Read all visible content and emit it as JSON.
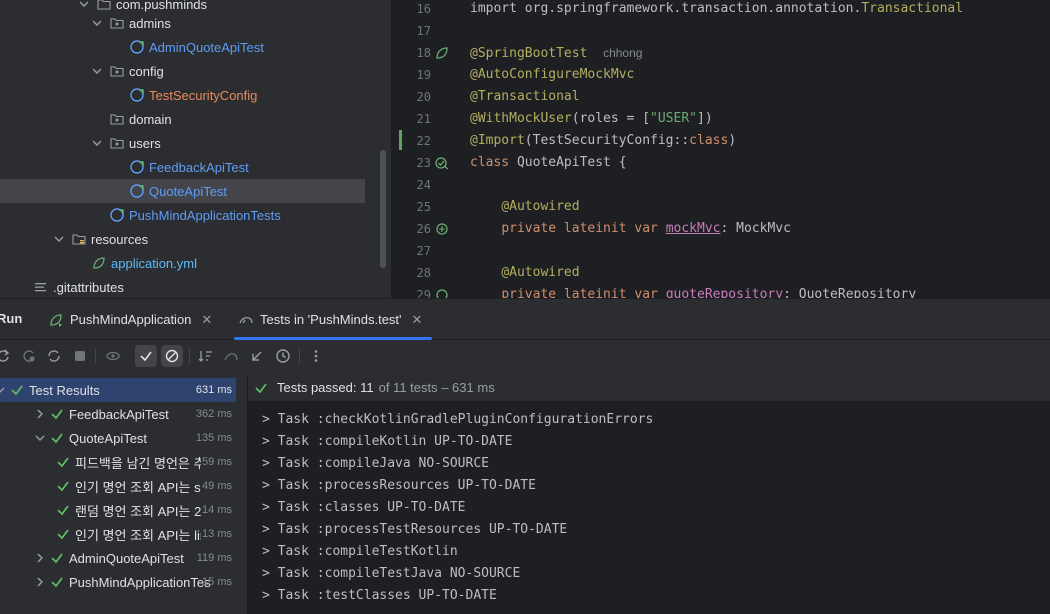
{
  "project_tree": {
    "items": [
      {
        "label": "com.pushminds",
        "kind": "package"
      },
      {
        "label": "admins",
        "kind": "package"
      },
      {
        "label": "AdminQuoteApiTest",
        "kind": "kotlin-test"
      },
      {
        "label": "config",
        "kind": "package"
      },
      {
        "label": "TestSecurityConfig",
        "kind": "kotlin-config"
      },
      {
        "label": "domain",
        "kind": "package"
      },
      {
        "label": "users",
        "kind": "package"
      },
      {
        "label": "FeedbackApiTest",
        "kind": "kotlin-test"
      },
      {
        "label": "QuoteApiTest",
        "kind": "kotlin-test"
      },
      {
        "label": "PushMindApplicationTests",
        "kind": "kotlin-test"
      },
      {
        "label": "resources",
        "kind": "resources-folder"
      },
      {
        "label": "application.yml",
        "kind": "yml"
      },
      {
        "label": ".gitattributes",
        "kind": "text"
      }
    ]
  },
  "editor": {
    "line_numbers": [
      "16",
      "17",
      "18",
      "19",
      "20",
      "21",
      "22",
      "23",
      "24",
      "25",
      "26",
      "27",
      "28",
      "29"
    ],
    "lines": [
      {
        "segments": [
          {
            "t": "import org.springframework.transaction.annotation.",
            "c": "plain-import"
          },
          {
            "t": "Transactional",
            "c": "ann"
          }
        ]
      },
      {
        "segments": []
      },
      {
        "segments": [
          {
            "t": "@SpringBootTest",
            "c": "ann"
          },
          {
            "t": "  ",
            "c": "plain"
          },
          {
            "t": "chhong",
            "c": "inlay"
          }
        ]
      },
      {
        "segments": [
          {
            "t": "@AutoConfigureMockMvc",
            "c": "ann"
          }
        ]
      },
      {
        "segments": [
          {
            "t": "@Transactional",
            "c": "ann"
          }
        ]
      },
      {
        "segments": [
          {
            "t": "@WithMockUser",
            "c": "ann"
          },
          {
            "t": "(roles = [",
            "c": "plain"
          },
          {
            "t": "\"USER\"",
            "c": "str"
          },
          {
            "t": "])",
            "c": "plain"
          }
        ]
      },
      {
        "segments": [
          {
            "t": "@Import",
            "c": "ann"
          },
          {
            "t": "(TestSecurityConfig::",
            "c": "plain"
          },
          {
            "t": "class",
            "c": "kw"
          },
          {
            "t": ")",
            "c": "plain"
          }
        ]
      },
      {
        "segments": [
          {
            "t": "class ",
            "c": "kw"
          },
          {
            "t": "QuoteApiTest {",
            "c": "plain"
          }
        ]
      },
      {
        "segments": []
      },
      {
        "segments": [
          {
            "t": "    ",
            "c": "plain"
          },
          {
            "t": "@Autowired",
            "c": "ann"
          }
        ]
      },
      {
        "segments": [
          {
            "t": "    ",
            "c": "plain"
          },
          {
            "t": "private lateinit var ",
            "c": "kw"
          },
          {
            "t": "mockMvc",
            "c": "prop"
          },
          {
            "t": ": MockMvc",
            "c": "plain"
          }
        ]
      },
      {
        "segments": []
      },
      {
        "segments": [
          {
            "t": "    ",
            "c": "plain"
          },
          {
            "t": "@Autowired",
            "c": "ann"
          }
        ]
      },
      {
        "segments": [
          {
            "t": "    ",
            "c": "plain"
          },
          {
            "t": "private lateinit var ",
            "c": "kw"
          },
          {
            "t": "quoteRepository",
            "c": "prop"
          },
          {
            "t": ": QuoteRepository",
            "c": "plain"
          }
        ]
      }
    ]
  },
  "tool_window": {
    "title": "Run",
    "tabs": [
      {
        "label": "PushMindApplication",
        "active": false
      },
      {
        "label": "Tests in 'PushMinds.test'",
        "active": true
      }
    ]
  },
  "test_tree": {
    "rows": [
      {
        "name": "Test Results",
        "time": "631 ms",
        "depth": 0
      },
      {
        "name": "FeedbackApiTest",
        "time": "362 ms",
        "depth": 1
      },
      {
        "name": "QuoteApiTest",
        "time": "135 ms",
        "depth": 1
      },
      {
        "name": "피드백을 남긴 명언은 추",
        "time": "59 ms",
        "depth": 2
      },
      {
        "name": "인기 명언 조회 API는 sc",
        "time": "49 ms",
        "depth": 2
      },
      {
        "name": "랜덤 명언 조회 API는 20",
        "time": "14 ms",
        "depth": 2
      },
      {
        "name": "인기 명언 조회 API는 lin",
        "time": "13 ms",
        "depth": 2
      },
      {
        "name": "AdminQuoteApiTest",
        "time": "119 ms",
        "depth": 1
      },
      {
        "name": "PushMindApplicationTes",
        "time": "15 ms",
        "depth": 1
      }
    ]
  },
  "console": {
    "status_passed": "Tests passed: 11",
    "status_detail": "of 11 tests – 631 ms",
    "lines": [
      "> Task :checkKotlinGradlePluginConfigurationErrors",
      "> Task :compileKotlin UP-TO-DATE",
      "> Task :compileJava NO-SOURCE",
      "> Task :processResources UP-TO-DATE",
      "> Task :classes UP-TO-DATE",
      "> Task :processTestResources UP-TO-DATE",
      "> Task :compileTestKotlin",
      "> Task :compileTestJava NO-SOURCE",
      "> Task :testClasses UP-TO-DATE"
    ]
  },
  "colors": {
    "accent": "#3574f0",
    "pass_green": "#5fb865",
    "selection": "#2e436e"
  }
}
